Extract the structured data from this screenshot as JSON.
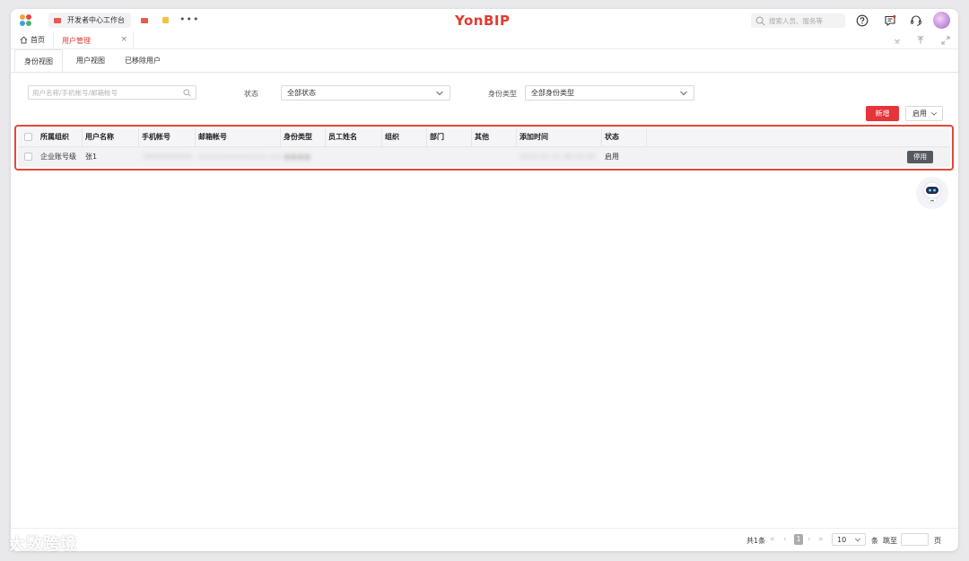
{
  "topbar": {
    "workbench_tab": "开发者中心工作台",
    "brand": "YonBIP",
    "search_placeholder": "搜索人员、服务等"
  },
  "tabs": {
    "home": "首页",
    "active": "用户管理",
    "close": "×"
  },
  "subtabs": [
    "身份视图",
    "用户视图",
    "已移除用户"
  ],
  "filters": {
    "search_placeholder": "用户名称/手机帐号/邮箱帐号",
    "status_label": "状态",
    "status_value": "全部状态",
    "identity_label": "身份类型",
    "identity_value": "全部身份类型"
  },
  "actions": {
    "add": "新增",
    "enable": "启用"
  },
  "table": {
    "columns": [
      "所属组织",
      "用户名称",
      "手机帐号",
      "邮箱帐号",
      "身份类型",
      "员工姓名",
      "组织",
      "部门",
      "其他",
      "添加时间",
      "状态"
    ],
    "rows": [
      {
        "org": "企业账号级",
        "name": "张1",
        "phone": "18900000000",
        "email": "xxxxxxxxxxxxxxxx.com",
        "identity": "■■■■",
        "time": "2024-01-01 00:00:00",
        "status": "启用",
        "action": "停用"
      }
    ]
  },
  "footer": {
    "total": "共1条",
    "current_page": "1",
    "page_size": "10",
    "per_unit": "条",
    "jump_label": "跳至",
    "page_unit": "页"
  },
  "watermark": "大数跨境",
  "colors": {
    "brand_red": "#e33b30",
    "primary_button": "#e5343a",
    "highlight_border": "#e5463b",
    "dark_button": "#555a60"
  }
}
